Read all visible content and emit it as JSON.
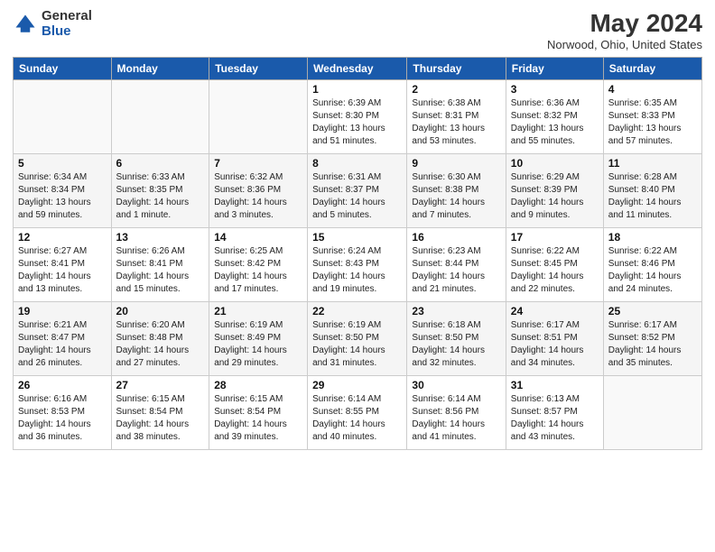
{
  "header": {
    "logo_general": "General",
    "logo_blue": "Blue",
    "month_year": "May 2024",
    "location": "Norwood, Ohio, United States"
  },
  "weekdays": [
    "Sunday",
    "Monday",
    "Tuesday",
    "Wednesday",
    "Thursday",
    "Friday",
    "Saturday"
  ],
  "weeks": [
    [
      {
        "day": "",
        "info": ""
      },
      {
        "day": "",
        "info": ""
      },
      {
        "day": "",
        "info": ""
      },
      {
        "day": "1",
        "info": "Sunrise: 6:39 AM\nSunset: 8:30 PM\nDaylight: 13 hours\nand 51 minutes."
      },
      {
        "day": "2",
        "info": "Sunrise: 6:38 AM\nSunset: 8:31 PM\nDaylight: 13 hours\nand 53 minutes."
      },
      {
        "day": "3",
        "info": "Sunrise: 6:36 AM\nSunset: 8:32 PM\nDaylight: 13 hours\nand 55 minutes."
      },
      {
        "day": "4",
        "info": "Sunrise: 6:35 AM\nSunset: 8:33 PM\nDaylight: 13 hours\nand 57 minutes."
      }
    ],
    [
      {
        "day": "5",
        "info": "Sunrise: 6:34 AM\nSunset: 8:34 PM\nDaylight: 13 hours\nand 59 minutes."
      },
      {
        "day": "6",
        "info": "Sunrise: 6:33 AM\nSunset: 8:35 PM\nDaylight: 14 hours\nand 1 minute."
      },
      {
        "day": "7",
        "info": "Sunrise: 6:32 AM\nSunset: 8:36 PM\nDaylight: 14 hours\nand 3 minutes."
      },
      {
        "day": "8",
        "info": "Sunrise: 6:31 AM\nSunset: 8:37 PM\nDaylight: 14 hours\nand 5 minutes."
      },
      {
        "day": "9",
        "info": "Sunrise: 6:30 AM\nSunset: 8:38 PM\nDaylight: 14 hours\nand 7 minutes."
      },
      {
        "day": "10",
        "info": "Sunrise: 6:29 AM\nSunset: 8:39 PM\nDaylight: 14 hours\nand 9 minutes."
      },
      {
        "day": "11",
        "info": "Sunrise: 6:28 AM\nSunset: 8:40 PM\nDaylight: 14 hours\nand 11 minutes."
      }
    ],
    [
      {
        "day": "12",
        "info": "Sunrise: 6:27 AM\nSunset: 8:41 PM\nDaylight: 14 hours\nand 13 minutes."
      },
      {
        "day": "13",
        "info": "Sunrise: 6:26 AM\nSunset: 8:41 PM\nDaylight: 14 hours\nand 15 minutes."
      },
      {
        "day": "14",
        "info": "Sunrise: 6:25 AM\nSunset: 8:42 PM\nDaylight: 14 hours\nand 17 minutes."
      },
      {
        "day": "15",
        "info": "Sunrise: 6:24 AM\nSunset: 8:43 PM\nDaylight: 14 hours\nand 19 minutes."
      },
      {
        "day": "16",
        "info": "Sunrise: 6:23 AM\nSunset: 8:44 PM\nDaylight: 14 hours\nand 21 minutes."
      },
      {
        "day": "17",
        "info": "Sunrise: 6:22 AM\nSunset: 8:45 PM\nDaylight: 14 hours\nand 22 minutes."
      },
      {
        "day": "18",
        "info": "Sunrise: 6:22 AM\nSunset: 8:46 PM\nDaylight: 14 hours\nand 24 minutes."
      }
    ],
    [
      {
        "day": "19",
        "info": "Sunrise: 6:21 AM\nSunset: 8:47 PM\nDaylight: 14 hours\nand 26 minutes."
      },
      {
        "day": "20",
        "info": "Sunrise: 6:20 AM\nSunset: 8:48 PM\nDaylight: 14 hours\nand 27 minutes."
      },
      {
        "day": "21",
        "info": "Sunrise: 6:19 AM\nSunset: 8:49 PM\nDaylight: 14 hours\nand 29 minutes."
      },
      {
        "day": "22",
        "info": "Sunrise: 6:19 AM\nSunset: 8:50 PM\nDaylight: 14 hours\nand 31 minutes."
      },
      {
        "day": "23",
        "info": "Sunrise: 6:18 AM\nSunset: 8:50 PM\nDaylight: 14 hours\nand 32 minutes."
      },
      {
        "day": "24",
        "info": "Sunrise: 6:17 AM\nSunset: 8:51 PM\nDaylight: 14 hours\nand 34 minutes."
      },
      {
        "day": "25",
        "info": "Sunrise: 6:17 AM\nSunset: 8:52 PM\nDaylight: 14 hours\nand 35 minutes."
      }
    ],
    [
      {
        "day": "26",
        "info": "Sunrise: 6:16 AM\nSunset: 8:53 PM\nDaylight: 14 hours\nand 36 minutes."
      },
      {
        "day": "27",
        "info": "Sunrise: 6:15 AM\nSunset: 8:54 PM\nDaylight: 14 hours\nand 38 minutes."
      },
      {
        "day": "28",
        "info": "Sunrise: 6:15 AM\nSunset: 8:54 PM\nDaylight: 14 hours\nand 39 minutes."
      },
      {
        "day": "29",
        "info": "Sunrise: 6:14 AM\nSunset: 8:55 PM\nDaylight: 14 hours\nand 40 minutes."
      },
      {
        "day": "30",
        "info": "Sunrise: 6:14 AM\nSunset: 8:56 PM\nDaylight: 14 hours\nand 41 minutes."
      },
      {
        "day": "31",
        "info": "Sunrise: 6:13 AM\nSunset: 8:57 PM\nDaylight: 14 hours\nand 43 minutes."
      },
      {
        "day": "",
        "info": ""
      }
    ]
  ]
}
